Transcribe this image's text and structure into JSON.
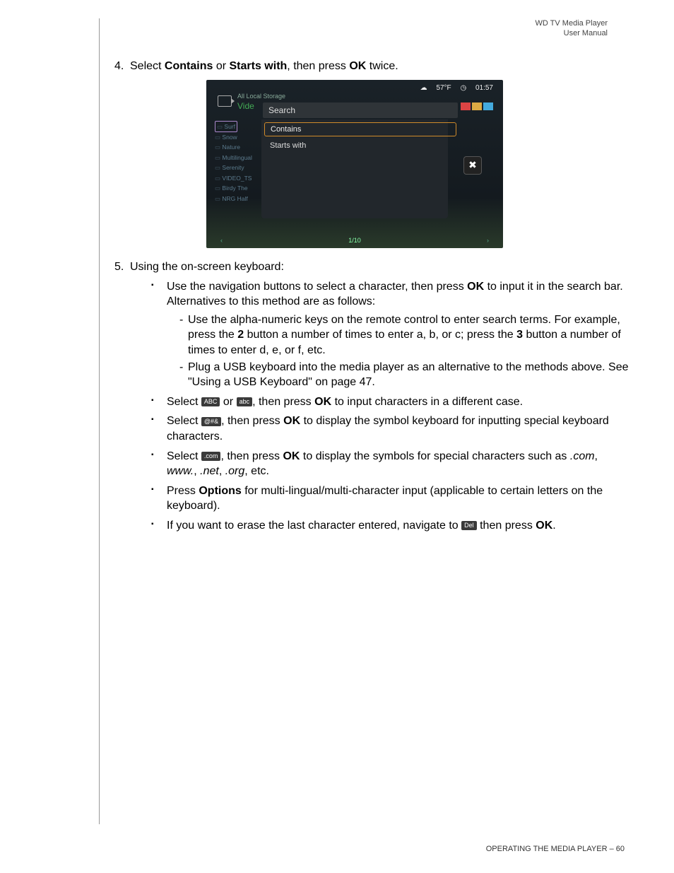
{
  "header": {
    "line1": "WD TV Media Player",
    "line2": "User Manual"
  },
  "steps": {
    "s4": {
      "num": "4.",
      "pre": "Select ",
      "b1": "Contains",
      "mid": " or ",
      "b2": "Starts with",
      "mid2": ", then press ",
      "b3": "OK",
      "post": " twice."
    },
    "s5": {
      "num": "5.",
      "text": "Using the on-screen keyboard:"
    }
  },
  "bullets": {
    "b1a": "Use the navigation buttons to select a character, then press ",
    "b1b": "OK",
    "b1c": " to input it in the search bar. Alternatives to this method are as follows:",
    "d1a": "Use the alpha-numeric keys on the remote control to enter search terms. For example, press the ",
    "d1b": "2",
    "d1c": " button a number of times to enter a, b, or c; press the ",
    "d1d": "3",
    "d1e": " button a number of times to enter d, e, or f, etc.",
    "d2": "Plug a USB keyboard into the media player as an alternative to the methods above. See \"Using a USB Keyboard\" on page 47.",
    "b2a": "Select ",
    "key_ABC": "ABC",
    "b2b": " or ",
    "key_abc": "abc",
    "b2c": ", then press ",
    "b2d": "OK",
    "b2e": " to input characters in a different case.",
    "b3a": "Select ",
    "key_sym": "@#&",
    "b3b": ", then press ",
    "b3c": "OK",
    "b3d": " to display the symbol keyboard for inputting special keyboard characters.",
    "b4a": "Select ",
    "key_com": ".com",
    "b4b": ", then press ",
    "b4c": "OK",
    "b4d": " to display the symbols for special characters such as ",
    "b4e": ".com",
    "b4f": ", ",
    "b4g": "www.",
    "b4h": ", ",
    "b4i": ".net",
    "b4j": ", ",
    "b4k": ".org",
    "b4l": ", etc.",
    "b5a": "Press ",
    "b5b": "Options",
    "b5c": " for multi-lingual/multi-character input (applicable to certain letters on the keyboard).",
    "b6a": "If you want to erase the last character entered, navigate to ",
    "key_del": "Del",
    "b6b": " then press ",
    "b6c": "OK",
    "b6d": "."
  },
  "screenshot": {
    "temp": "57°F",
    "time": "01:57",
    "all_local_storage": "All Local Storage",
    "vide": "Vide",
    "search": "Search",
    "contains": "Contains",
    "starts_with": "Starts with",
    "pager": "1/10",
    "close": "✖",
    "side": [
      "Surf",
      "Snow",
      "Nature",
      "Multilingual",
      "Serenity",
      "VIDEO_TS",
      "Birdy The",
      "NRG Half"
    ]
  },
  "footer": {
    "section": "OPERATING THE MEDIA PLAYER",
    "sep": " – ",
    "pagenum": "60"
  }
}
